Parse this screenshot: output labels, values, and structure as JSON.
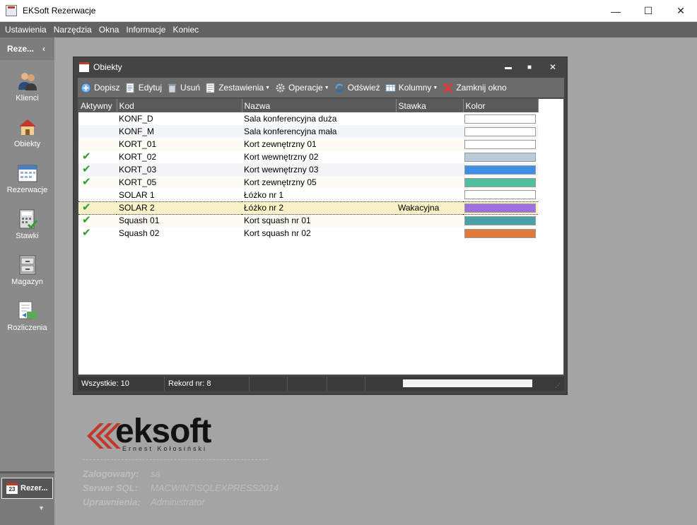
{
  "window": {
    "title": "EKSoft Rezerwacje",
    "controls": {
      "minimize": "—",
      "maximize": "☐",
      "close": "✕"
    }
  },
  "menu": [
    "Ustawienia",
    "Narzędzia",
    "Okna",
    "Informacje",
    "Koniec"
  ],
  "sidebar": {
    "header": "Reze...",
    "header_chevron": "‹",
    "items": [
      {
        "label": "Klienci",
        "icon": "clients-icon"
      },
      {
        "label": "Obiekty",
        "icon": "house-icon"
      },
      {
        "label": "Rezerwacje",
        "icon": "calendar-icon"
      },
      {
        "label": "Stawki",
        "icon": "calculator-icon"
      },
      {
        "label": "Magazyn",
        "icon": "cabinet-icon"
      },
      {
        "label": "Rozliczenia",
        "icon": "invoice-icon"
      }
    ],
    "active_tab": {
      "label": "Rezer...",
      "day": "23"
    },
    "scroll_down": "▼"
  },
  "child_window": {
    "title": "Obiekty",
    "controls": {
      "minimize": "▬",
      "maximize": "■",
      "close": "✕"
    },
    "toolbar": [
      {
        "label": "Dopisz",
        "icon": "add-icon",
        "dropdown": false
      },
      {
        "label": "Edytuj",
        "icon": "edit-icon",
        "dropdown": false
      },
      {
        "label": "Usuń",
        "icon": "trash-icon",
        "dropdown": false
      },
      {
        "label": "Zestawienia",
        "icon": "report-icon",
        "dropdown": true
      },
      {
        "label": "Operacje",
        "icon": "gear-icon",
        "dropdown": true
      },
      {
        "label": "Odśwież",
        "icon": "refresh-icon",
        "dropdown": false
      },
      {
        "label": "Kolumny",
        "icon": "columns-icon",
        "dropdown": true
      },
      {
        "label": "Zamknij okno",
        "icon": "close-red-icon",
        "dropdown": false
      }
    ],
    "grid": {
      "columns": [
        "Aktywny",
        "Kod",
        "Nazwa",
        "Stawka",
        "Kolor"
      ],
      "rows": [
        {
          "active": false,
          "kod": "KONF_D",
          "nazwa": "Sala konferencyjna duża",
          "stawka": "",
          "kolor": "#ffffff"
        },
        {
          "active": false,
          "kod": "KONF_M",
          "nazwa": "Sala konferencyjna mała",
          "stawka": "",
          "kolor": "#ffffff"
        },
        {
          "active": false,
          "kod": "KORT_01",
          "nazwa": "Kort zewnętrzny 01",
          "stawka": "",
          "kolor": "#ffffff"
        },
        {
          "active": true,
          "kod": "KORT_02",
          "nazwa": "Kort wewnętrzny 02",
          "stawka": "",
          "kolor": "#bccbd9"
        },
        {
          "active": true,
          "kod": "KORT_03",
          "nazwa": "Kort wewnętrzny 03",
          "stawka": "",
          "kolor": "#3d8fe6"
        },
        {
          "active": true,
          "kod": "KORT_05",
          "nazwa": "Kort zewnętrzny 05",
          "stawka": "",
          "kolor": "#4fbfa0"
        },
        {
          "active": false,
          "kod": "SOLAR 1",
          "nazwa": "Łóżko nr 1",
          "stawka": "",
          "kolor": "#ffffff"
        },
        {
          "active": true,
          "kod": "SOLAR 2",
          "nazwa": "Łóżko nr 2",
          "stawka": "Wakacyjna",
          "kolor": "#9f6fe0",
          "selected": true
        },
        {
          "active": true,
          "kod": "Squash 01",
          "nazwa": "Kort squash nr 01",
          "stawka": "",
          "kolor": "#4aa0a8"
        },
        {
          "active": true,
          "kod": "Squash 02",
          "nazwa": "Kort squash nr 02",
          "stawka": "",
          "kolor": "#e0783a"
        }
      ]
    },
    "status": {
      "total": "Wszystkie: 10",
      "record": "Rekord nr: 8"
    }
  },
  "logo": {
    "word": "eksoft",
    "tagline": "Ernest Kołosiński"
  },
  "info": [
    {
      "key": "Zalogowany:",
      "value": "sa"
    },
    {
      "key": "Serwer SQL:",
      "value": "MACWIN7\\SQLEXPRESS2014"
    },
    {
      "key": "Uprawnienia:",
      "value": "Administrator"
    }
  ],
  "colors": {
    "menubar": "#626262",
    "sidebar": "#8a8a8a",
    "workspace": "#a4a4a4",
    "accent_red": "#c0392b"
  }
}
